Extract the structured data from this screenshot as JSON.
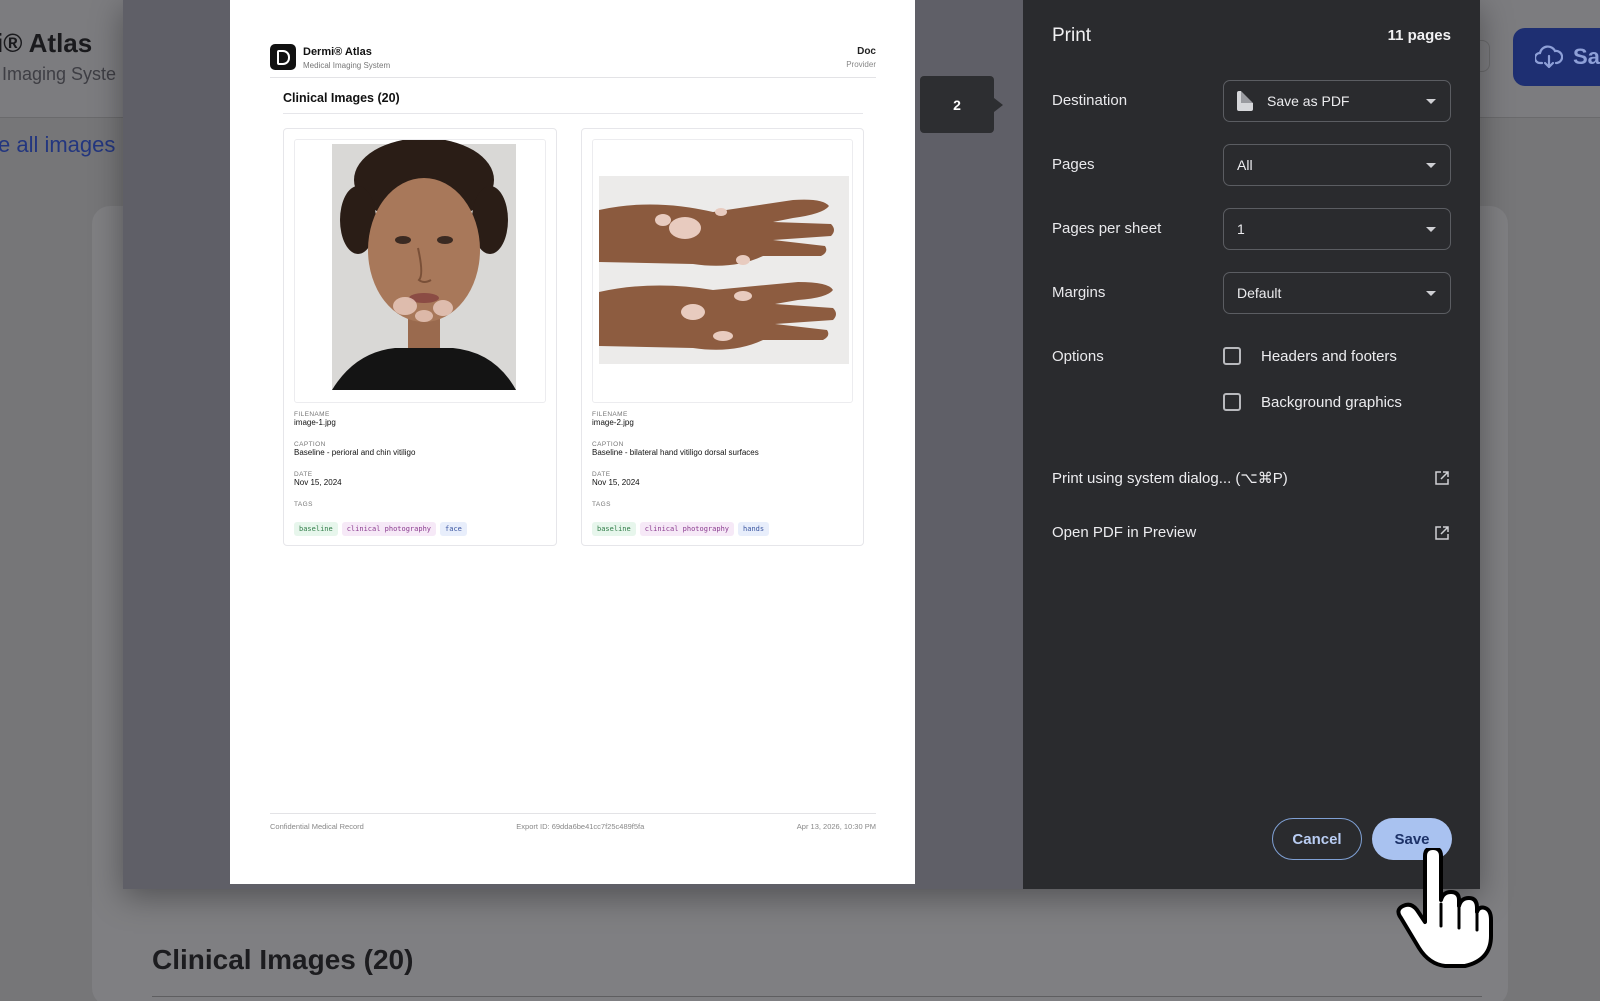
{
  "background_app": {
    "title": "i® Atlas",
    "subtitle": "Imaging Syste",
    "see_all_link": "e all images",
    "section_heading": "Clinical Images (20)",
    "save_button_label": "Sa"
  },
  "preview": {
    "page_indicator": "2",
    "doc_header": {
      "brand": "Dermi® Atlas",
      "brand_sub": "Medical Imaging System",
      "right_title": "Doc",
      "right_sub": "Provider"
    },
    "section_title": "Clinical Images (20)",
    "images": [
      {
        "filename_label": "FILENAME",
        "filename": "image-1.jpg",
        "caption_label": "CAPTION",
        "caption": "Baseline - perioral and chin vitiligo",
        "date_label": "DATE",
        "date": "Nov 15, 2024",
        "tags_label": "TAGS",
        "tags": [
          "baseline",
          "clinical photography",
          "face"
        ]
      },
      {
        "filename_label": "FILENAME",
        "filename": "image-2.jpg",
        "caption_label": "CAPTION",
        "caption": "Baseline - bilateral hand vitiligo dorsal surfaces",
        "date_label": "DATE",
        "date": "Nov 15, 2024",
        "tags_label": "TAGS",
        "tags": [
          "baseline",
          "clinical photography",
          "hands"
        ]
      }
    ],
    "footer": {
      "left": "Confidential Medical Record",
      "center": "Export ID: 69dda6be41cc7f25c489f5fa",
      "right": "Apr 13, 2026, 10:30 PM"
    }
  },
  "print_settings": {
    "title": "Print",
    "page_count": "11 pages",
    "destination_label": "Destination",
    "destination_value": "Save as PDF",
    "pages_label": "Pages",
    "pages_value": "All",
    "pages_per_sheet_label": "Pages per sheet",
    "pages_per_sheet_value": "1",
    "margins_label": "Margins",
    "margins_value": "Default",
    "options_label": "Options",
    "option_headers_footers": "Headers and footers",
    "option_background_graphics": "Background graphics",
    "system_dialog_link": "Print using system dialog... (⌥⌘P)",
    "open_pdf_link": "Open PDF in Preview",
    "cancel_label": "Cancel",
    "save_label": "Save"
  },
  "colors": {
    "panel_bg": "#2a2b2e",
    "preview_bg": "#5f5f67",
    "save_button": "#a9c2f0",
    "cancel_border": "#7fa0d4"
  }
}
